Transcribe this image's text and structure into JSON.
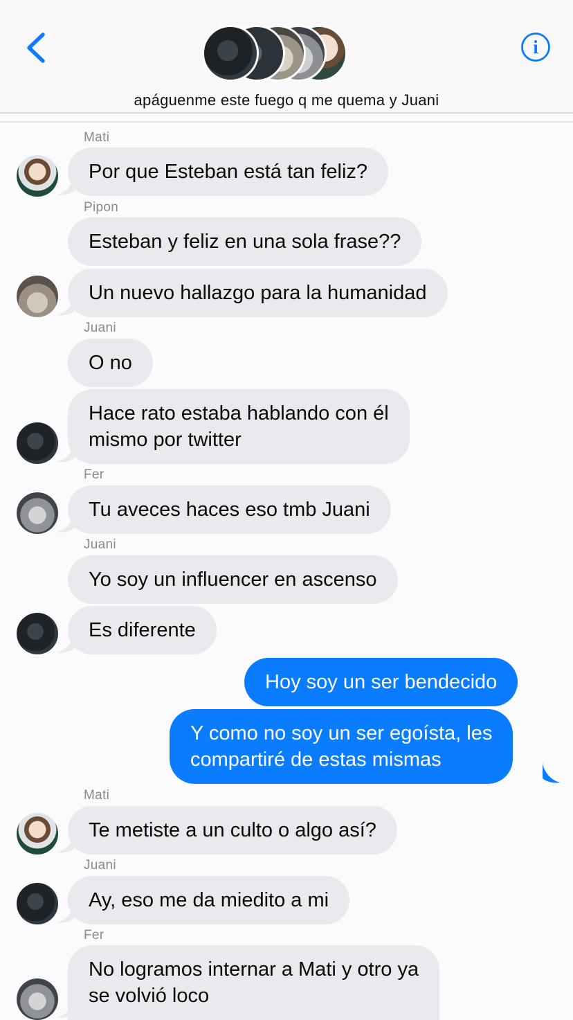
{
  "header": {
    "title": "apáguenme este fuego q me quema y Juani",
    "back_icon": "chevron-left-icon",
    "info_icon": "info-icon",
    "accent": "#0a7cff"
  },
  "colors": {
    "incoming_bubble": "#e9e9ee",
    "outgoing_bubble": "#0a7cff",
    "sender_label": "#8a8a8e"
  },
  "messages": [
    {
      "sender": "Mati",
      "text": "Por que Esteban está tan feliz?"
    },
    {
      "sender": "Pipon",
      "text": "Esteban y feliz en una sola frase??"
    },
    {
      "text": "Un nuevo hallazgo para la humanidad"
    },
    {
      "sender": "Juani",
      "text": "O no"
    },
    {
      "lines": [
        "Hace rato estaba hablando con él",
        "mismo por twitter"
      ]
    },
    {
      "sender": "Fer",
      "text": "Tu aveces haces eso tmb Juani"
    },
    {
      "sender": "Juani",
      "text": "Yo soy un influencer en ascenso"
    },
    {
      "text": "Es diferente"
    },
    {
      "outgoing": true,
      "text": "Hoy soy un ser  bendecido"
    },
    {
      "outgoing": true,
      "lines": [
        "Y como no soy un ser egoísta, les",
        "compartiré de estas mismas"
      ]
    },
    {
      "sender": "Mati",
      "text": "Te metiste a un culto o algo así?"
    },
    {
      "sender": "Juani",
      "text": "Ay, eso me da miedito a mi"
    },
    {
      "sender": "Fer",
      "lines": [
        "No logramos internar a Mati y otro ya",
        "se volvió loco"
      ]
    }
  ]
}
